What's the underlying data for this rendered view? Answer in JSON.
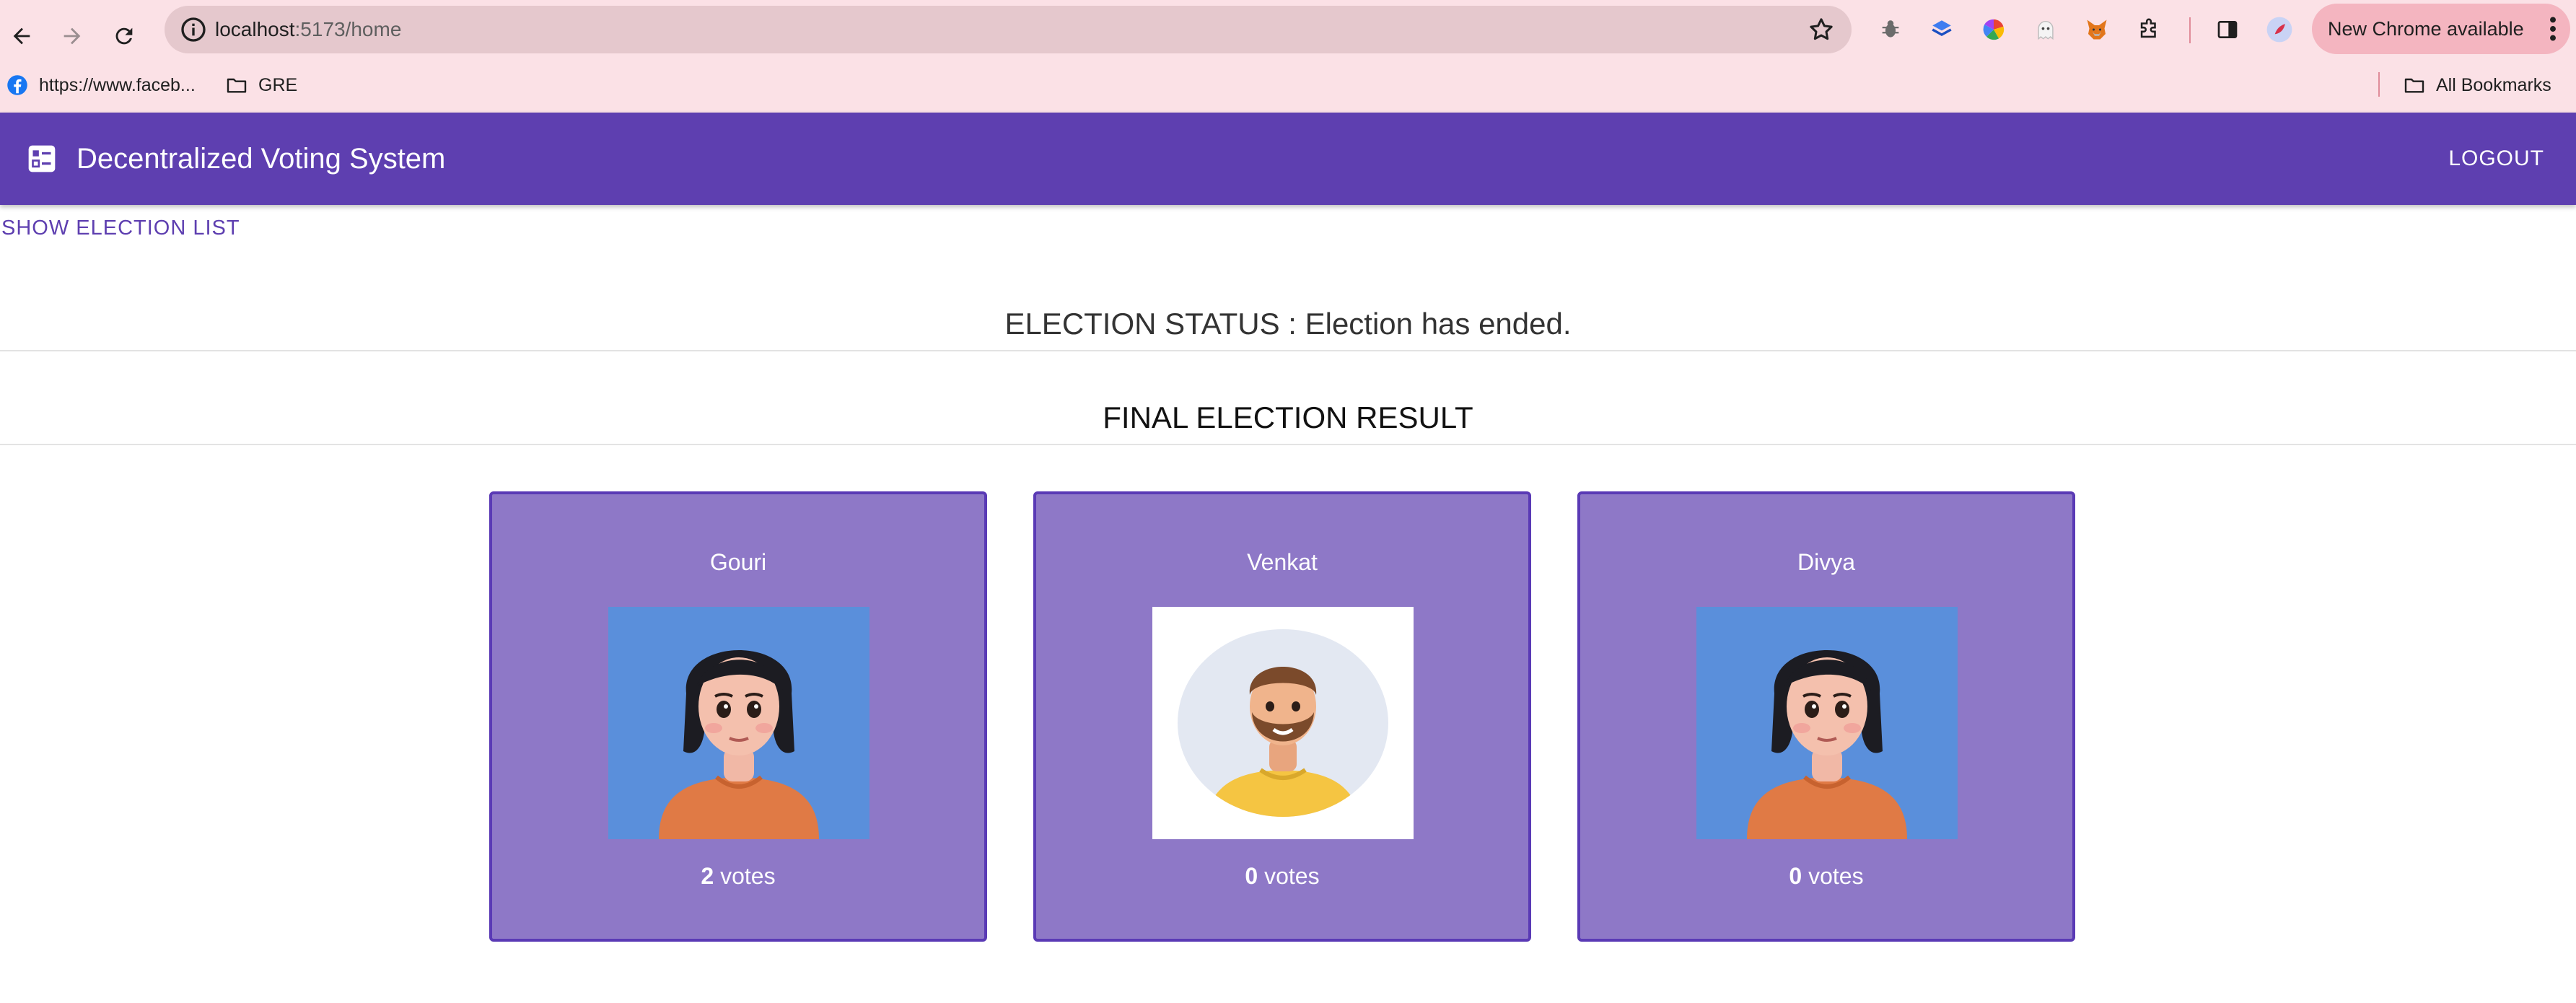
{
  "browser": {
    "url_host": "localhost",
    "url_path": ":5173/home",
    "update_label": "New Chrome available",
    "bookmarks": [
      {
        "label": "https://www.faceb..."
      },
      {
        "label": "GRE"
      }
    ],
    "all_bookmarks_label": "All Bookmarks"
  },
  "app": {
    "title": "Decentralized Voting System",
    "logout_label": "LOGOUT"
  },
  "content": {
    "show_list_label": "SHOW ELECTION LIST",
    "status_text": "ELECTION STATUS : Election has ended.",
    "result_title": "FINAL ELECTION RESULT",
    "votes_word": "votes",
    "candidates": [
      {
        "name": "Gouri",
        "votes": "2",
        "avatar": "female-avatar-icon"
      },
      {
        "name": "Venkat",
        "votes": "0",
        "avatar": "male-avatar-icon"
      },
      {
        "name": "Divya",
        "votes": "0",
        "avatar": "female-avatar-icon"
      }
    ]
  },
  "colors": {
    "app_bar": "#5e3fb0",
    "card_bg": "#8e78c7",
    "card_border": "#5a3ab5",
    "chrome_bg": "#fbe1e6"
  }
}
